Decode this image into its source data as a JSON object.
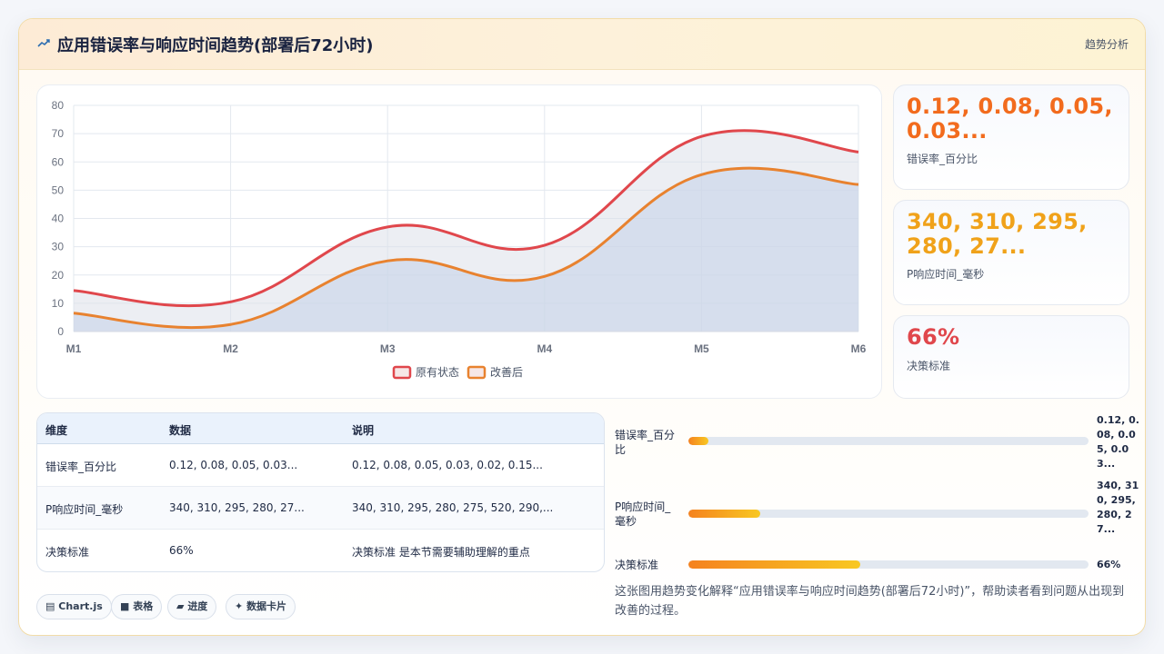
{
  "header": {
    "title": "应用错误率与响应时间趋势(部署后72小时)",
    "tag": "趋势分析"
  },
  "chart_data": {
    "type": "area",
    "categories": [
      "M1",
      "M2",
      "M3",
      "M4",
      "M5",
      "M6"
    ],
    "ylim": [
      0,
      80
    ],
    "yticks": [
      0,
      10,
      20,
      30,
      40,
      50,
      60,
      70,
      80
    ],
    "grid": true,
    "legend": "bottom",
    "series": [
      {
        "name": "原有状态",
        "values": [
          14.5,
          10.5,
          37,
          30.5,
          69,
          63.5
        ],
        "color": "#e0474c"
      },
      {
        "name": "改善后",
        "values": [
          6.5,
          2.5,
          25,
          19.5,
          55.5,
          52
        ],
        "color": "#e8822f"
      }
    ]
  },
  "kpis": [
    {
      "value": "0.12, 0.08, 0.05, 0.03...",
      "label": "错误率_百分比",
      "color": "#f26b1d"
    },
    {
      "value": "340, 310, 295, 280, 27...",
      "label": "P响应时间_毫秒",
      "color": "#f0a21a"
    },
    {
      "value": "66%",
      "label": "决策标准",
      "color": "#e0474c"
    }
  ],
  "table": {
    "headers": [
      "维度",
      "数据",
      "说明"
    ],
    "rows": [
      [
        "错误率_百分比",
        "0.12, 0.08, 0.05, 0.03...",
        "0.12, 0.08, 0.05, 0.03, 0.02, 0.15..."
      ],
      [
        "P响应时间_毫秒",
        "340, 310, 295, 280, 27...",
        "340, 310, 295, 280, 275, 520, 290,..."
      ],
      [
        "决策标准",
        "66%",
        "决策标准 是本节需要辅助理解的重点"
      ]
    ]
  },
  "chips": [
    {
      "icon": "▤",
      "label": "Chart.js"
    },
    {
      "icon": "■",
      "label": "表格"
    },
    {
      "icon": "▰",
      "label": "进度"
    },
    {
      "icon": "✦",
      "label": "数据卡片"
    }
  ],
  "progress": [
    {
      "label": "错误率_百分比",
      "value": "0.12, 0.08, 0.05, 0.03...",
      "fraction": 0.05
    },
    {
      "label": "P响应时间_毫秒",
      "value": "340, 310, 295, 280, 27...",
      "fraction": 0.18
    },
    {
      "label": "决策标准",
      "value": "66%",
      "fraction": 0.43
    }
  ],
  "note": "这张图用趋势变化解释“应用错误率与响应时间趋势(部署后72小时)”，帮助读者看到问题从出现到改善的过程。"
}
